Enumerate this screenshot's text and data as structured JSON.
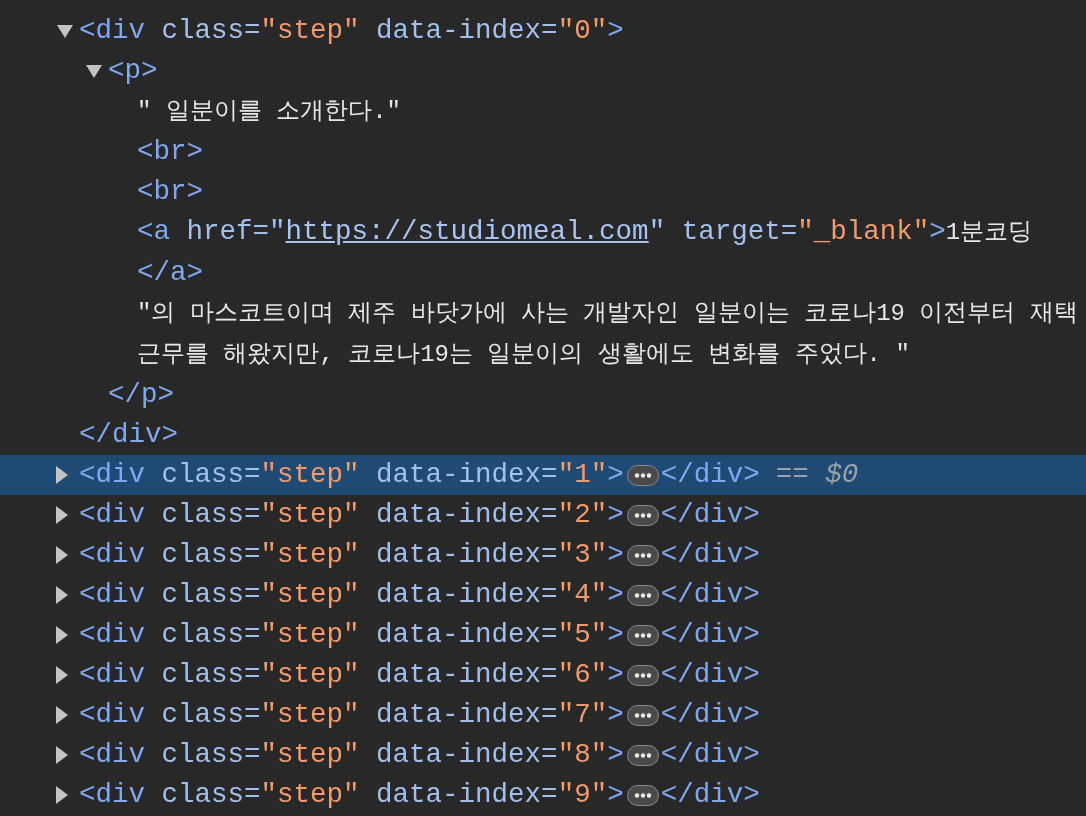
{
  "nodes": [
    {
      "tokens": [
        {
          "kind": "tag",
          "t": "<div"
        },
        {
          "kind": "attr",
          "t": " class="
        },
        {
          "kind": "value",
          "t": "\"step\""
        },
        {
          "kind": "attr",
          "t": " data-index="
        },
        {
          "kind": "value",
          "t": "\"0\""
        },
        {
          "kind": "tag",
          "t": ">"
        }
      ],
      "expanded": true,
      "selected": false,
      "close": [
        {
          "kind": "tag",
          "t": "</div>"
        }
      ],
      "children": [
        {
          "tokens": [
            {
              "kind": "tag",
              "t": "<p>"
            }
          ],
          "expanded": true,
          "selected": false,
          "close": [
            {
              "kind": "tag",
              "t": "</p>"
            }
          ],
          "children": [
            {
              "tokens": [
                {
                  "kind": "text",
                  "t": "\" 일분이를 소개한다.\""
                }
              ]
            },
            {
              "tokens": [
                {
                  "kind": "tag",
                  "t": "<br>"
                }
              ]
            },
            {
              "tokens": [
                {
                  "kind": "tag",
                  "t": "<br>"
                }
              ]
            },
            {
              "tokens": [
                {
                  "kind": "tag",
                  "t": "<a"
                },
                {
                  "kind": "attr",
                  "t": " href="
                },
                {
                  "kind": "attr",
                  "t": "\""
                },
                {
                  "kind": "link",
                  "t": "https://studiomeal.com"
                },
                {
                  "kind": "attr",
                  "t": "\""
                },
                {
                  "kind": "attr",
                  "t": " target="
                },
                {
                  "kind": "value",
                  "t": "\"_blank\""
                },
                {
                  "kind": "tag",
                  "t": ">"
                },
                {
                  "kind": "text",
                  "t": "1분코딩"
                }
              ],
              "close": [
                {
                  "kind": "tag",
                  "t": "</a>"
                }
              ]
            },
            {
              "tokens": [
                {
                  "kind": "text",
                  "t": "\"의 마스코트이며 제주 바닷가에 사는 개발자인 일분이는 코로나19 이전부터 재택근무를 해왔지만, 코로나19는 일분이의 생활에도 변화를 주었다. \""
                }
              ]
            }
          ]
        }
      ]
    },
    {
      "tokens": [
        {
          "kind": "tag",
          "t": "<div"
        },
        {
          "kind": "attr",
          "t": " class="
        },
        {
          "kind": "value",
          "t": "\"step\""
        },
        {
          "kind": "attr",
          "t": " data-index="
        },
        {
          "kind": "value",
          "t": "\"1\""
        },
        {
          "kind": "tag",
          "t": ">"
        }
      ],
      "expanded": false,
      "selected": true,
      "close": [
        {
          "kind": "tag",
          "t": "</div>"
        }
      ],
      "hint": "== *$0*"
    },
    {
      "tokens": [
        {
          "kind": "tag",
          "t": "<div"
        },
        {
          "kind": "attr",
          "t": " class="
        },
        {
          "kind": "value",
          "t": "\"step\""
        },
        {
          "kind": "attr",
          "t": " data-index="
        },
        {
          "kind": "value",
          "t": "\"2\""
        },
        {
          "kind": "tag",
          "t": ">"
        }
      ],
      "expanded": false,
      "selected": false,
      "close": [
        {
          "kind": "tag",
          "t": "</div>"
        }
      ]
    },
    {
      "tokens": [
        {
          "kind": "tag",
          "t": "<div"
        },
        {
          "kind": "attr",
          "t": " class="
        },
        {
          "kind": "value",
          "t": "\"step\""
        },
        {
          "kind": "attr",
          "t": " data-index="
        },
        {
          "kind": "value",
          "t": "\"3\""
        },
        {
          "kind": "tag",
          "t": ">"
        }
      ],
      "expanded": false,
      "selected": false,
      "close": [
        {
          "kind": "tag",
          "t": "</div>"
        }
      ]
    },
    {
      "tokens": [
        {
          "kind": "tag",
          "t": "<div"
        },
        {
          "kind": "attr",
          "t": " class="
        },
        {
          "kind": "value",
          "t": "\"step\""
        },
        {
          "kind": "attr",
          "t": " data-index="
        },
        {
          "kind": "value",
          "t": "\"4\""
        },
        {
          "kind": "tag",
          "t": ">"
        }
      ],
      "expanded": false,
      "selected": false,
      "close": [
        {
          "kind": "tag",
          "t": "</div>"
        }
      ]
    },
    {
      "tokens": [
        {
          "kind": "tag",
          "t": "<div"
        },
        {
          "kind": "attr",
          "t": " class="
        },
        {
          "kind": "value",
          "t": "\"step\""
        },
        {
          "kind": "attr",
          "t": " data-index="
        },
        {
          "kind": "value",
          "t": "\"5\""
        },
        {
          "kind": "tag",
          "t": ">"
        }
      ],
      "expanded": false,
      "selected": false,
      "close": [
        {
          "kind": "tag",
          "t": "</div>"
        }
      ]
    },
    {
      "tokens": [
        {
          "kind": "tag",
          "t": "<div"
        },
        {
          "kind": "attr",
          "t": " class="
        },
        {
          "kind": "value",
          "t": "\"step\""
        },
        {
          "kind": "attr",
          "t": " data-index="
        },
        {
          "kind": "value",
          "t": "\"6\""
        },
        {
          "kind": "tag",
          "t": ">"
        }
      ],
      "expanded": false,
      "selected": false,
      "close": [
        {
          "kind": "tag",
          "t": "</div>"
        }
      ]
    },
    {
      "tokens": [
        {
          "kind": "tag",
          "t": "<div"
        },
        {
          "kind": "attr",
          "t": " class="
        },
        {
          "kind": "value",
          "t": "\"step\""
        },
        {
          "kind": "attr",
          "t": " data-index="
        },
        {
          "kind": "value",
          "t": "\"7\""
        },
        {
          "kind": "tag",
          "t": ">"
        }
      ],
      "expanded": false,
      "selected": false,
      "close": [
        {
          "kind": "tag",
          "t": "</div>"
        }
      ]
    },
    {
      "tokens": [
        {
          "kind": "tag",
          "t": "<div"
        },
        {
          "kind": "attr",
          "t": " class="
        },
        {
          "kind": "value",
          "t": "\"step\""
        },
        {
          "kind": "attr",
          "t": " data-index="
        },
        {
          "kind": "value",
          "t": "\"8\""
        },
        {
          "kind": "tag",
          "t": ">"
        }
      ],
      "expanded": false,
      "selected": false,
      "close": [
        {
          "kind": "tag",
          "t": "</div>"
        }
      ]
    },
    {
      "tokens": [
        {
          "kind": "tag",
          "t": "<div"
        },
        {
          "kind": "attr",
          "t": " class="
        },
        {
          "kind": "value",
          "t": "\"step\""
        },
        {
          "kind": "attr",
          "t": " data-index="
        },
        {
          "kind": "value",
          "t": "\"9\""
        },
        {
          "kind": "tag",
          "t": ">"
        }
      ],
      "expanded": false,
      "selected": false,
      "close": [
        {
          "kind": "tag",
          "t": "</div>"
        }
      ]
    }
  ]
}
